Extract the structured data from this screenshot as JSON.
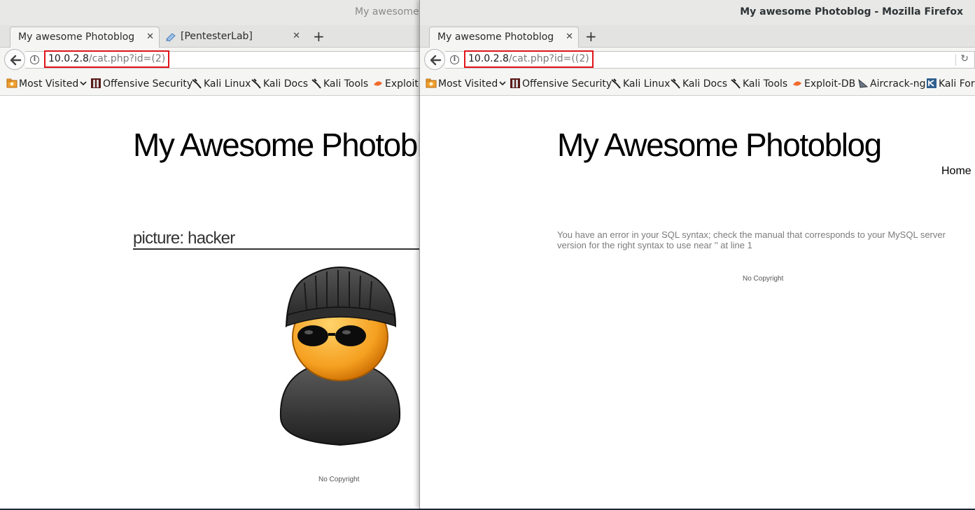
{
  "left_window": {
    "title": "My awesome",
    "tabs": [
      {
        "label": "My awesome Photoblog",
        "close": "✕"
      },
      {
        "label": "[PentesterLab]",
        "close": "✕"
      }
    ],
    "new_tab": "+",
    "url": {
      "host": "10.0.2.8",
      "path": "/cat.php?id=(2)"
    },
    "bookmarks": [
      "Most Visited",
      "Offensive Security",
      "Kali Linux",
      "Kali Docs",
      "Kali Tools",
      "Exploit-"
    ],
    "page": {
      "site_title": "My Awesome Photobl",
      "picture_heading": "picture: hacker",
      "footer": "No Copyright"
    }
  },
  "right_window": {
    "title": "My awesome Photoblog - Mozilla Firefox",
    "tabs": [
      {
        "label": "My awesome Photoblog",
        "close": "✕"
      }
    ],
    "new_tab": "+",
    "url": {
      "host": "10.0.2.8",
      "path": "/cat.php?id=((2)"
    },
    "bookmarks": [
      "Most Visited",
      "Offensive Security",
      "Kali Linux",
      "Kali Docs",
      "Kali Tools",
      "Exploit-DB",
      "Aircrack-ng",
      "Kali Foru"
    ],
    "page": {
      "site_title": "My Awesome Photoblog",
      "nav_home": "Home |",
      "sql_error": "You have an error in your SQL syntax; check the manual that corresponds to your MySQL server version for the right syntax to use near '' at line 1",
      "footer": "No Copyright"
    }
  },
  "colors": {
    "highlight_box": "#e0141a",
    "url_path": "#7a7a7a"
  }
}
